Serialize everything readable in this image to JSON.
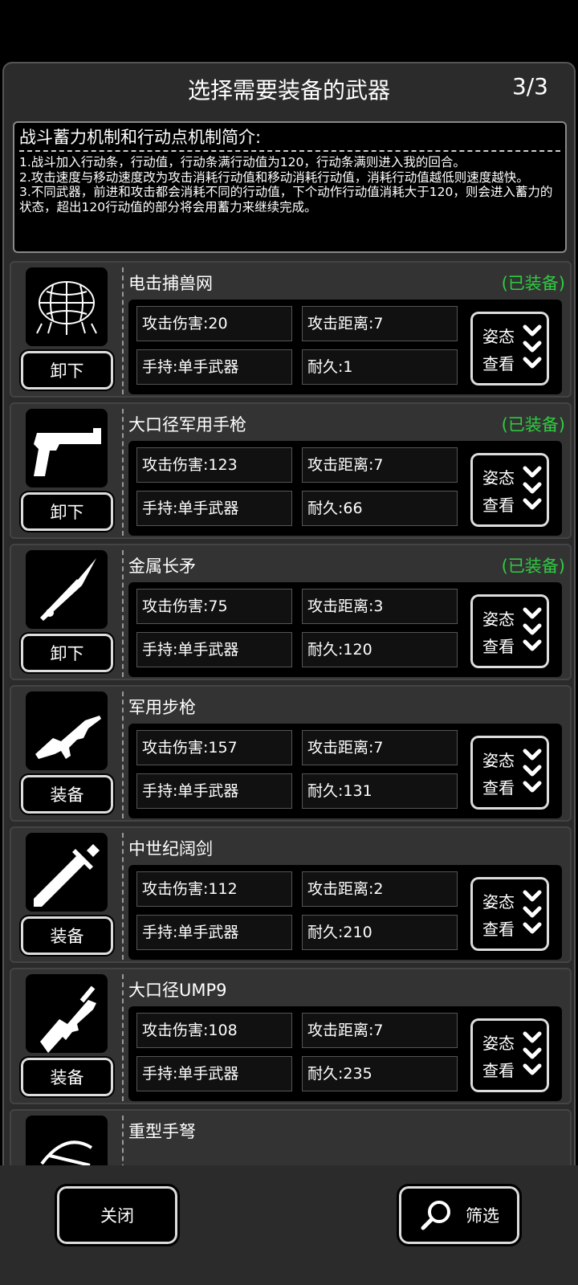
{
  "header": {
    "title": "选择需要装备的武器",
    "page_counter": "3/3"
  },
  "intro": {
    "title": "战斗蓄力机制和行动点机制简介:",
    "lines": [
      "1.战斗加入行动条，行动值，行动条满行动值为120，行动条满则进入我的回合。",
      "2.攻击速度与移动速度改为攻击消耗行动值和移动消耗行动值，消耗行动值越低则速度越快。",
      "3.不同武器，前进和攻击都会消耗不同的行动值，下个动作行动值消耗大于120，则会进入蓄力的状态，超出120行动值的部分将会用蓄力来继续完成。"
    ]
  },
  "weapons": [
    {
      "name": "电击捕兽网",
      "status": "(已装备)",
      "button": "卸下",
      "damage": "攻击伤害:20",
      "range": "攻击距离:7",
      "hold": "手持:单手武器",
      "durability": "耐久:1",
      "stance_1": "姿态",
      "stance_2": "查看",
      "icon": "net-icon"
    },
    {
      "name": "大口径军用手枪",
      "status": "(已装备)",
      "button": "卸下",
      "damage": "攻击伤害:123",
      "range": "攻击距离:7",
      "hold": "手持:单手武器",
      "durability": "耐久:66",
      "stance_1": "姿态",
      "stance_2": "查看",
      "icon": "pistol-icon"
    },
    {
      "name": "金属长矛",
      "status": "(已装备)",
      "button": "卸下",
      "damage": "攻击伤害:75",
      "range": "攻击距离:3",
      "hold": "手持:单手武器",
      "durability": "耐久:120",
      "stance_1": "姿态",
      "stance_2": "查看",
      "icon": "spear-icon"
    },
    {
      "name": "军用步枪",
      "status": "",
      "button": "装备",
      "damage": "攻击伤害:157",
      "range": "攻击距离:7",
      "hold": "手持:单手武器",
      "durability": "耐久:131",
      "stance_1": "姿态",
      "stance_2": "查看",
      "icon": "rifle-icon"
    },
    {
      "name": "中世纪阔剑",
      "status": "",
      "button": "装备",
      "damage": "攻击伤害:112",
      "range": "攻击距离:2",
      "hold": "手持:单手武器",
      "durability": "耐久:210",
      "stance_1": "姿态",
      "stance_2": "查看",
      "icon": "sword-icon"
    },
    {
      "name": "大口径UMP9",
      "status": "",
      "button": "装备",
      "damage": "攻击伤害:108",
      "range": "攻击距离:7",
      "hold": "手持:单手武器",
      "durability": "耐久:235",
      "stance_1": "姿态",
      "stance_2": "查看",
      "icon": "smg-icon"
    },
    {
      "name": "重型手弩",
      "status": "",
      "button": "",
      "damage": "",
      "range": "",
      "hold": "",
      "durability": "",
      "stance_1": "",
      "stance_2": "",
      "icon": "crossbow-icon"
    }
  ],
  "footer": {
    "close_label": "关闭",
    "filter_label": "筛选"
  },
  "colors": {
    "equipped": "#2ecc40",
    "panel": "#2b2b2b",
    "card": "#333333"
  }
}
